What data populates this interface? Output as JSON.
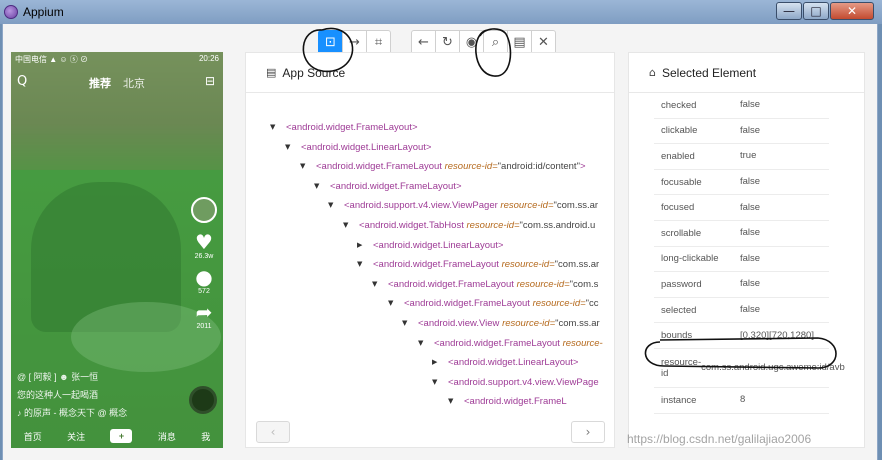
{
  "window": {
    "title": "Appium",
    "minimize_glyph": "—",
    "maximize_glyph": "□",
    "close_glyph": "✕"
  },
  "toolbar": {
    "group1": [
      {
        "icon": "select-element-icon",
        "glyph": "⊡",
        "active": true
      },
      {
        "icon": "swipe-icon",
        "glyph": "→",
        "active": false
      },
      {
        "icon": "tap-by-coordinates-icon",
        "glyph": "⌗",
        "active": false
      }
    ],
    "group2": [
      {
        "icon": "back-icon",
        "glyph": "←"
      },
      {
        "icon": "refresh-icon",
        "glyph": "↻"
      },
      {
        "icon": "eye-icon",
        "glyph": "◉"
      },
      {
        "icon": "search-icon",
        "glyph": "⌕"
      },
      {
        "icon": "copy-xml-icon",
        "glyph": "▤"
      },
      {
        "icon": "close-icon",
        "glyph": "✕"
      }
    ]
  },
  "device": {
    "status_left": "中国电信 ▲ ☺ ⓢ ⊘",
    "status_right": "20:26",
    "nav_search": "Q",
    "nav_tab1": "推荐",
    "nav_tab2": "北京",
    "nav_scan": "⊟",
    "likes": "26.3w",
    "comments": "572",
    "shares": "2011",
    "caption_user": "@ [ 阿毅 ] ☻  张一恒",
    "caption_text": "您的这种人一起喝酒",
    "caption_music": "♪ 的原声 - 概念天下  @ 概念",
    "bottom": [
      "首页",
      "关注",
      "+",
      "消息",
      "我"
    ]
  },
  "source_panel": {
    "icon": "file-icon",
    "icon_glyph": "▤",
    "title": "App Source",
    "prev_glyph": "‹",
    "next_glyph": "›",
    "nodes": [
      {
        "caret": "▼",
        "tag": "<android.widget.FrameLayout>",
        "attr": "",
        "val": "",
        "end": ""
      },
      {
        "caret": "▼",
        "tag": "<android.widget.LinearLayout>",
        "attr": "",
        "val": "",
        "end": ""
      },
      {
        "caret": "▼",
        "tag": "<android.widget.FrameLayout ",
        "attr": "resource-id=",
        "val": "\"android:id/content\"",
        "end": ">"
      },
      {
        "caret": "▼",
        "tag": "<android.widget.FrameLayout>",
        "attr": "",
        "val": "",
        "end": ""
      },
      {
        "caret": "▼",
        "tag": "<android.support.v4.view.ViewPager ",
        "attr": "resource-id=",
        "val": "\"com.ss.ar",
        "end": ""
      },
      {
        "caret": "▼",
        "tag": "<android.widget.TabHost ",
        "attr": "resource-id=",
        "val": "\"com.ss.android.u",
        "end": ""
      },
      {
        "caret": "▶",
        "tag": "<android.widget.LinearLayout>",
        "attr": "",
        "val": "",
        "end": ""
      },
      {
        "caret": "▼",
        "tag": "<android.widget.FrameLayout ",
        "attr": "resource-id=",
        "val": "\"com.ss.ar",
        "end": ""
      },
      {
        "caret": "▼",
        "tag": "<android.widget.FrameLayout ",
        "attr": "resource-id=",
        "val": "\"com.s",
        "end": ""
      },
      {
        "caret": "▼",
        "tag": "<android.widget.FrameLayout ",
        "attr": "resource-id=",
        "val": "\"cc",
        "end": ""
      },
      {
        "caret": "▼",
        "tag": "<android.view.View ",
        "attr": "resource-id=",
        "val": "\"com.ss.ar",
        "end": ""
      },
      {
        "caret": "▼",
        "tag": "<android.widget.FrameLayout ",
        "attr": "resource-",
        "val": "",
        "end": ""
      },
      {
        "caret": "▶",
        "tag": "<android.widget.LinearLayout>",
        "attr": "",
        "val": "",
        "end": ""
      },
      {
        "caret": "▼",
        "tag": "<android.support.v4.view.ViewPage",
        "attr": "",
        "val": "",
        "end": ""
      },
      {
        "caret": "▼",
        "tag": "<android.widget.FrameL",
        "attr": "",
        "val": "",
        "end": ""
      }
    ]
  },
  "element_panel": {
    "icon": "tag-icon",
    "icon_glyph": "⌂",
    "title": "Selected Element",
    "attributes": [
      {
        "key": "checked",
        "value": "false"
      },
      {
        "key": "clickable",
        "value": "false"
      },
      {
        "key": "enabled",
        "value": "true"
      },
      {
        "key": "focusable",
        "value": "false"
      },
      {
        "key": "focused",
        "value": "false"
      },
      {
        "key": "scrollable",
        "value": "false"
      },
      {
        "key": "long-clickable",
        "value": "false"
      },
      {
        "key": "password",
        "value": "false"
      },
      {
        "key": "selected",
        "value": "false"
      },
      {
        "key": "bounds",
        "value": "[0,320][720,1280]"
      },
      {
        "key": "resource-id",
        "value": "com.ss.android.ugc.aweme:id/avb"
      },
      {
        "key": "instance",
        "value": "8"
      }
    ]
  },
  "watermark": "https://blog.csdn.net/galilajiao2006"
}
